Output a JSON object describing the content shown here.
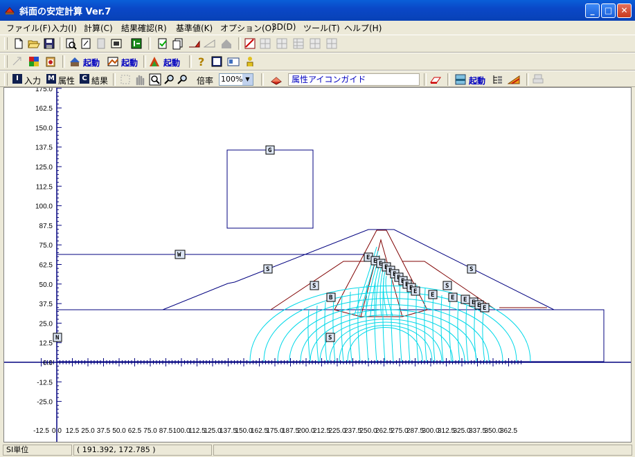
{
  "window": {
    "title": "斜面の安定計算 Ver.7"
  },
  "menu": [
    "ファイル(F)",
    "入力(I)",
    "計算(C)",
    "結果確認(R)",
    "基準値(K)",
    "オプション(O)",
    "3D(D)",
    "ツール(T)",
    "ヘルプ(H)"
  ],
  "toolbar2": {
    "launch1": "起動",
    "launch2": "起動",
    "launch3": "起動"
  },
  "toolbar3": {
    "mode_input_letter": "I",
    "mode_input_label": "入力",
    "mode_attr_letter": "M",
    "mode_attr_label": "属性",
    "mode_result_letter": "C",
    "mode_result_label": "結果",
    "zoom_label": "倍率",
    "zoom_value": "100%",
    "guide_label": "属性アイコンガイド",
    "launch4": "起動"
  },
  "canvas": {
    "y_ticks": [
      "175.0",
      "162.5",
      "150.0",
      "137.5",
      "125.0",
      "112.5",
      "100.0",
      "87.5",
      "75.0",
      "62.5",
      "50.0",
      "37.5",
      "25.0",
      "12.5",
      "0.0",
      "-12.5",
      "-25.0"
    ],
    "x_ticks": [
      "-12.5",
      "0.0",
      "12.5",
      "25.0",
      "37.5",
      "50.0",
      "62.5",
      "75.0",
      "87.5",
      "100.0",
      "112.5",
      "125.0",
      "137.5",
      "150.0",
      "162.5",
      "175.0",
      "187.5",
      "200.0",
      "212.5",
      "225.0",
      "237.5",
      "250.0",
      "262.5",
      "275.0",
      "287.5",
      "300.0",
      "312.5",
      "325.0",
      "337.5",
      "350.0",
      "362.5"
    ],
    "markers": {
      "g": "G",
      "w": "W",
      "s": "S",
      "b": "B",
      "e": "E",
      "n": "N"
    },
    "colors": {
      "boundary": "#00007f",
      "zone": "#7f0000",
      "seepage": "#00d8e8"
    }
  },
  "status": {
    "units": "SI単位",
    "coords": "( 191.392,  172.785 )"
  }
}
